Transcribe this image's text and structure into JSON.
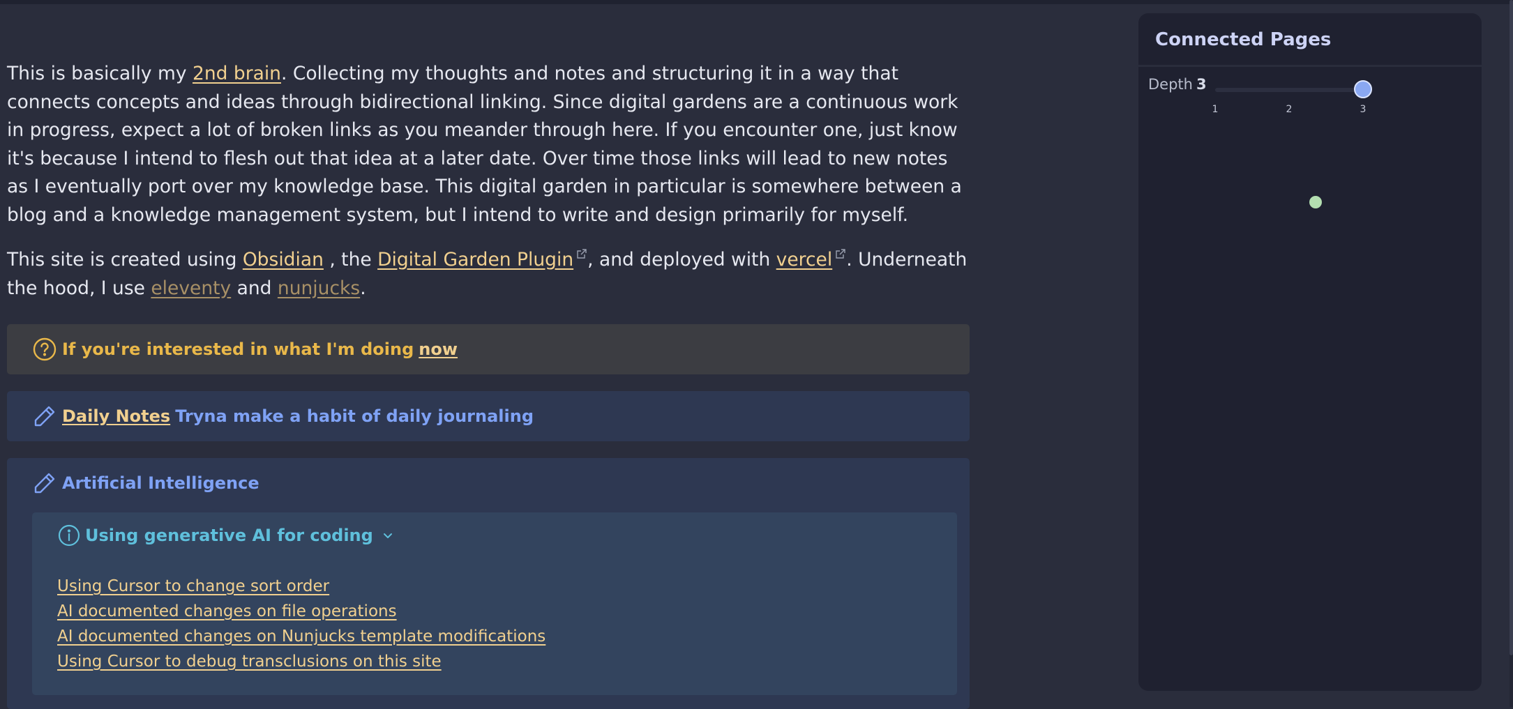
{
  "intro": {
    "p1": {
      "t1": "This is basically my ",
      "brain_link": "2nd brain",
      "t2": ". Collecting my thoughts and notes and structuring it in a way that connects concepts and ideas through bidirectional linking. Since digital gardens are a continuous work in progress, expect a lot of broken links as you meander through here. If you encounter one, just know it's because I intend to flesh out that idea at a later date. Over time those links will lead to new notes as I eventually port over my knowledge base. This digital garden in particular is somewhere between a blog and a knowledge management system, but I intend to write and design primarily for myself."
    },
    "p2": {
      "t1": "This site is created using ",
      "obsidian": "Obsidian",
      "t2": " , the ",
      "plugin": "Digital Garden Plugin",
      "t3": ", and deployed with ",
      "vercel": "vercel",
      "t4": ". Underneath the hood, I use ",
      "eleventy": "eleventy",
      "t5": " and ",
      "nunjucks": "nunjucks",
      "t6": "."
    }
  },
  "callouts": {
    "question": {
      "text": "If you're interested in what I'm doing",
      "link": "now",
      "color": "#e9b84a",
      "icon": "question-circle-icon"
    },
    "daily": {
      "link": "Daily Notes",
      "text": "Tryna make a habit of daily journaling",
      "color": "#7fa2f5",
      "icon": "pencil-icon"
    },
    "ai": {
      "title": "Artificial Intelligence",
      "icon": "pencil-icon",
      "nested": {
        "title": "Using generative AI for coding",
        "icon": "info-circle-icon",
        "color": "#5fc0dc",
        "links": [
          "Using Cursor to change sort order",
          "AI documented changes on file operations",
          "AI documented changes on Nunjucks template modifications",
          "Using Cursor to debug transclusions on this site"
        ]
      }
    }
  },
  "graph_panel": {
    "title": "Connected Pages",
    "depth_label": "Depth",
    "depth_value": "3",
    "ticks": [
      "1",
      "2",
      "3"
    ],
    "slider": {
      "min": 1,
      "max": 3,
      "value": 3
    },
    "node_color": "#b3deb0"
  },
  "colors": {
    "link": "#f1d08f",
    "background": "#2a2d3c",
    "panel": "#1f2130"
  }
}
